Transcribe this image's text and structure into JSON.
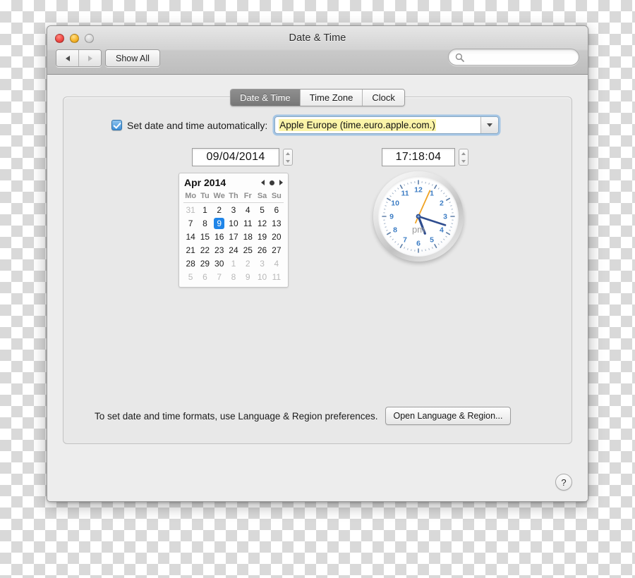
{
  "window": {
    "title": "Date & Time",
    "traffic_lights": [
      {
        "name": "close",
        "color": "#f04a45"
      },
      {
        "name": "minimize",
        "color": "#f5b429"
      },
      {
        "name": "zoom",
        "color": "#d8d8d8"
      }
    ],
    "toolbar": {
      "back_label": "◀",
      "forward_label": "▶",
      "show_all_label": "Show All",
      "search_placeholder": "",
      "search_value": "",
      "search_icon": "search-icon"
    }
  },
  "tabs": [
    {
      "label": "Date & Time",
      "active": true
    },
    {
      "label": "Time Zone",
      "active": false
    },
    {
      "label": "Clock",
      "active": false
    }
  ],
  "auto_row": {
    "checkbox_checked": true,
    "label": "Set date and time automatically:",
    "server_value": "Apple Europe (time.euro.apple.com.)",
    "highlight_color": "#fbf4a8",
    "focus_ring_color": "#6eaae1",
    "dropdown_icon": "chevron-down-icon"
  },
  "date_field": {
    "value": "09/04/2014",
    "stepper_up_icon": "stepper-up-icon",
    "stepper_down_icon": "stepper-down-icon"
  },
  "time_field": {
    "value": "17:18:04",
    "stepper_up_icon": "stepper-up-icon",
    "stepper_down_icon": "stepper-down-icon"
  },
  "calendar": {
    "month_label": "Apr 2014",
    "nav": {
      "prev_icon": "caret-left-icon",
      "today_icon": "dot-icon",
      "next_icon": "caret-right-icon"
    },
    "weekday_headers": [
      "Mo",
      "Tu",
      "We",
      "Th",
      "Fr",
      "Sa",
      "Su"
    ],
    "selected_day": 9,
    "selection_color": "#1f85e8",
    "weeks": [
      [
        {
          "d": "31",
          "dim": true
        },
        {
          "d": "1"
        },
        {
          "d": "2"
        },
        {
          "d": "3"
        },
        {
          "d": "4"
        },
        {
          "d": "5"
        },
        {
          "d": "6"
        }
      ],
      [
        {
          "d": "7"
        },
        {
          "d": "8"
        },
        {
          "d": "9",
          "sel": true
        },
        {
          "d": "10"
        },
        {
          "d": "11"
        },
        {
          "d": "12"
        },
        {
          "d": "13"
        }
      ],
      [
        {
          "d": "14"
        },
        {
          "d": "15"
        },
        {
          "d": "16"
        },
        {
          "d": "17"
        },
        {
          "d": "18"
        },
        {
          "d": "19"
        },
        {
          "d": "20"
        }
      ],
      [
        {
          "d": "21"
        },
        {
          "d": "22"
        },
        {
          "d": "23"
        },
        {
          "d": "24"
        },
        {
          "d": "25"
        },
        {
          "d": "26"
        },
        {
          "d": "27"
        }
      ],
      [
        {
          "d": "28"
        },
        {
          "d": "29"
        },
        {
          "d": "30"
        },
        {
          "d": "1",
          "dim": true
        },
        {
          "d": "2",
          "dim": true
        },
        {
          "d": "3",
          "dim": true
        },
        {
          "d": "4",
          "dim": true
        }
      ],
      [
        {
          "d": "5",
          "dim": true
        },
        {
          "d": "6",
          "dim": true
        },
        {
          "d": "7",
          "dim": true
        },
        {
          "d": "8",
          "dim": true
        },
        {
          "d": "9",
          "dim": true
        },
        {
          "d": "10",
          "dim": true
        },
        {
          "d": "11",
          "dim": true
        }
      ]
    ]
  },
  "clock": {
    "ampm_label": "pm",
    "numerals": [
      "12",
      "1",
      "2",
      "3",
      "4",
      "5",
      "6",
      "7",
      "8",
      "9",
      "10",
      "11"
    ],
    "numeral_color": "#3b7cc4",
    "hand_color": "#2f4d8f",
    "second_hand_color": "#f0a323",
    "hour_angle": 159,
    "minute_angle": 108,
    "second_angle": 24
  },
  "footer": {
    "text": "To set date and time formats, use Language & Region preferences.",
    "button_label": "Open Language & Region...",
    "help_label": "?"
  }
}
